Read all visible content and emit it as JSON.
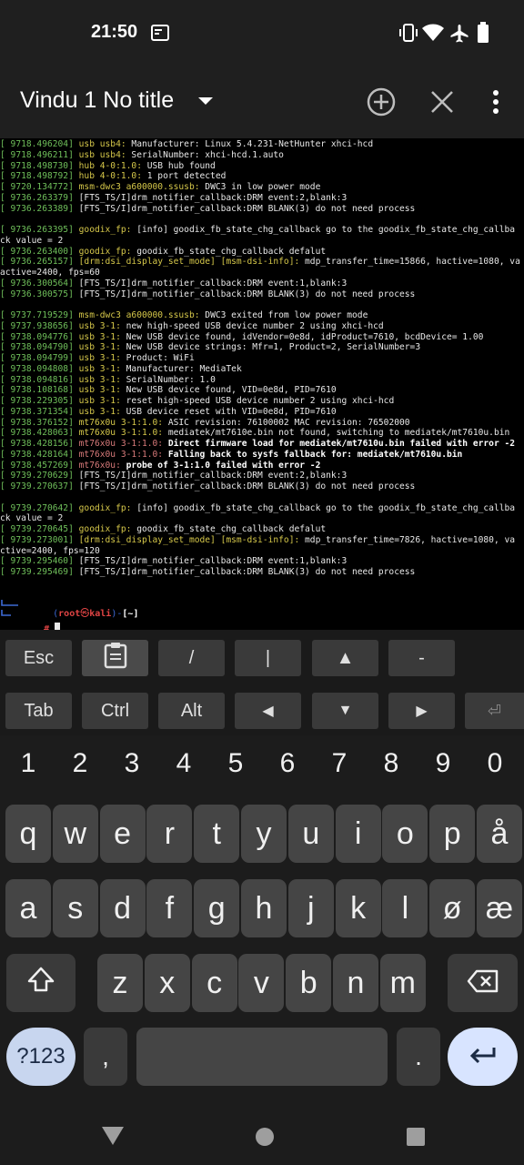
{
  "status_bar": {
    "time": "21:50",
    "icons": [
      "screenshot-icon",
      "vibrate-icon",
      "wifi-icon",
      "airplane-icon",
      "battery-icon"
    ]
  },
  "app_bar": {
    "title": "Vindu 1 No title",
    "icons": [
      "dropdown-arrow-icon",
      "add-session-icon",
      "close-session-icon",
      "overflow-menu-icon"
    ]
  },
  "terminal": {
    "lines": [
      {
        "ts": "[ 9718.496204]",
        "sub": "usb usb4:",
        "subc": "y",
        "msg": " Manufacturer: Linux 5.4.231-NetHunter xhci-hcd"
      },
      {
        "ts": "[ 9718.496211]",
        "sub": "usb usb4:",
        "subc": "y",
        "msg": " SerialNumber: xhci-hcd.1.auto"
      },
      {
        "ts": "[ 9718.498730]",
        "sub": "hub 4-0:1.0:",
        "subc": "y",
        "msg": " USB hub found"
      },
      {
        "ts": "[ 9718.498792]",
        "sub": "hub 4-0:1.0:",
        "subc": "y",
        "msg": " 1 port detected"
      },
      {
        "ts": "[ 9720.134772]",
        "sub": "msm-dwc3 a600000.ssusb:",
        "subc": "y",
        "msg": " DWC3 in low power mode"
      },
      {
        "ts": "[ 9736.263379]",
        "sub": "",
        "subc": "",
        "msg": " [FTS_TS/I]drm_notifier_callback:DRM event:2,blank:3"
      },
      {
        "ts": "[ 9736.263389]",
        "sub": "",
        "subc": "",
        "msg": " [FTS_TS/I]drm_notifier_callback:DRM BLANK(3) do not need process"
      },
      {
        "ts": "",
        "sub": "",
        "subc": "",
        "msg": ""
      },
      {
        "ts": "[ 9736.263395]",
        "sub": "goodix_fp:",
        "subc": "y",
        "msg": " [info] goodix_fb_state_chg_callback go to the goodix_fb_state_chg_callba"
      },
      {
        "ts": "",
        "sub": "",
        "subc": "",
        "msg": "ck value = 2"
      },
      {
        "ts": "[ 9736.263400]",
        "sub": "goodix_fp:",
        "subc": "y",
        "msg": " goodix_fb_state_chg_callback defalut"
      },
      {
        "ts": "[ 9736.265157]",
        "sub": "[drm:dsi_display_set_mode] [msm-dsi-info]:",
        "subc": "y",
        "msg": " mdp_transfer_time=15866, hactive=1080, va"
      },
      {
        "ts": "",
        "sub": "",
        "subc": "",
        "msg": "active=2400, fps=60"
      },
      {
        "ts": "[ 9736.300564]",
        "sub": "",
        "subc": "",
        "msg": " [FTS_TS/I]drm_notifier_callback:DRM event:1,blank:3"
      },
      {
        "ts": "[ 9736.300575]",
        "sub": "",
        "subc": "",
        "msg": " [FTS_TS/I]drm_notifier_callback:DRM BLANK(3) do not need process"
      },
      {
        "ts": "",
        "sub": "",
        "subc": "",
        "msg": ""
      },
      {
        "ts": "[ 9737.719529]",
        "sub": "msm-dwc3 a600000.ssusb:",
        "subc": "y",
        "msg": " DWC3 exited from low power mode"
      },
      {
        "ts": "[ 9737.938656]",
        "sub": "usb 3-1:",
        "subc": "y",
        "msg": " new high-speed USB device number 2 using xhci-hcd"
      },
      {
        "ts": "[ 9738.094776]",
        "sub": "usb 3-1:",
        "subc": "y",
        "msg": " New USB device found, idVendor=0e8d, idProduct=7610, bcdDevice= 1.00"
      },
      {
        "ts": "[ 9738.094790]",
        "sub": "usb 3-1:",
        "subc": "y",
        "msg": " New USB device strings: Mfr=1, Product=2, SerialNumber=3"
      },
      {
        "ts": "[ 9738.094799]",
        "sub": "usb 3-1:",
        "subc": "y",
        "msg": " Product: WiFi"
      },
      {
        "ts": "[ 9738.094808]",
        "sub": "usb 3-1:",
        "subc": "y",
        "msg": " Manufacturer: MediaTek"
      },
      {
        "ts": "[ 9738.094816]",
        "sub": "usb 3-1:",
        "subc": "y",
        "msg": " SerialNumber: 1.0"
      },
      {
        "ts": "[ 9738.108168]",
        "sub": "usb 3-1:",
        "subc": "y",
        "msg": " New USB device found, VID=0e8d, PID=7610"
      },
      {
        "ts": "[ 9738.229305]",
        "sub": "usb 3-1:",
        "subc": "y",
        "msg": " reset high-speed USB device number 2 using xhci-hcd"
      },
      {
        "ts": "[ 9738.371354]",
        "sub": "usb 3-1:",
        "subc": "y",
        "msg": " USB device reset with VID=0e8d, PID=7610"
      },
      {
        "ts": "[ 9738.376152]",
        "sub": "mt76x0u 3-1:1.0:",
        "subc": "y",
        "msg": " ASIC revision: 76100002 MAC revision: 76502000"
      },
      {
        "ts": "[ 9738.428063]",
        "sub": "mt76x0u 3-1:1.0:",
        "subc": "y",
        "msg": " mediatek/mt7610e.bin not found, switching to mediatek/mt7610u.bin"
      },
      {
        "ts": "[ 9738.428156]",
        "sub": "mt76x0u 3-1:1.0:",
        "subc": "r",
        "msg": " Direct firmware load for mediatek/mt7610u.bin failed with error -2",
        "bold": true
      },
      {
        "ts": "[ 9738.428164]",
        "sub": "mt76x0u 3-1:1.0:",
        "subc": "r",
        "msg": " Falling back to sysfs fallback for: mediatek/mt7610u.bin",
        "bold": true
      },
      {
        "ts": "[ 9738.457269]",
        "sub": "mt76x0u:",
        "subc": "r",
        "msg": " probe of 3-1:1.0 failed with error -2",
        "bold": true
      },
      {
        "ts": "[ 9739.270629]",
        "sub": "",
        "subc": "",
        "msg": " [FTS_TS/I]drm_notifier_callback:DRM event:2,blank:3"
      },
      {
        "ts": "[ 9739.270637]",
        "sub": "",
        "subc": "",
        "msg": " [FTS_TS/I]drm_notifier_callback:DRM BLANK(3) do not need process"
      },
      {
        "ts": "",
        "sub": "",
        "subc": "",
        "msg": ""
      },
      {
        "ts": "[ 9739.270642]",
        "sub": "goodix_fp:",
        "subc": "y",
        "msg": " [info] goodix_fb_state_chg_callback go to the goodix_fb_state_chg_callba"
      },
      {
        "ts": "",
        "sub": "",
        "subc": "",
        "msg": "ck value = 2"
      },
      {
        "ts": "[ 9739.270645]",
        "sub": "goodix_fp:",
        "subc": "y",
        "msg": " goodix_fb_state_chg_callback defalut"
      },
      {
        "ts": "[ 9739.273001]",
        "sub": "[drm:dsi_display_set_mode] [msm-dsi-info]:",
        "subc": "y",
        "msg": " mdp_transfer_time=7826, hactive=1080, va"
      },
      {
        "ts": "",
        "sub": "",
        "subc": "",
        "msg": "ctive=2400, fps=120"
      },
      {
        "ts": "[ 9739.295460]",
        "sub": "",
        "subc": "",
        "msg": " [FTS_TS/I]drm_notifier_callback:DRM event:1,blank:3"
      },
      {
        "ts": "[ 9739.295469]",
        "sub": "",
        "subc": "",
        "msg": " [FTS_TS/I]drm_notifier_callback:DRM BLANK(3) do not need process"
      }
    ],
    "prompt_user": "root",
    "prompt_at": "㉿",
    "prompt_host": "kali",
    "prompt_dir": "[~]",
    "prompt_symbol": "#"
  },
  "extra_keys": {
    "row1": [
      "Esc",
      "clipboard-icon",
      "/",
      "|",
      "▲",
      "-"
    ],
    "row2": [
      "Tab",
      "Ctrl",
      "Alt",
      "◀",
      "▼",
      "▶",
      "⏎"
    ]
  },
  "keyboard": {
    "numbers": [
      "1",
      "2",
      "3",
      "4",
      "5",
      "6",
      "7",
      "8",
      "9",
      "0"
    ],
    "row1": [
      "q",
      "w",
      "e",
      "r",
      "t",
      "y",
      "u",
      "i",
      "o",
      "p",
      "å"
    ],
    "row2": [
      "a",
      "s",
      "d",
      "f",
      "g",
      "h",
      "j",
      "k",
      "l",
      "ø",
      "æ"
    ],
    "row3": [
      "z",
      "x",
      "c",
      "v",
      "b",
      "n",
      "m"
    ],
    "symbols_label": "?123",
    "comma": ",",
    "period": "."
  },
  "nav_bar": {
    "icons": [
      "back-icon",
      "home-icon",
      "recents-icon"
    ]
  },
  "colors": {
    "timestamp": "#6fbf5a",
    "subsystem": "#d6c84a",
    "prompt_user": "#e04444",
    "prompt_frame": "#3d6ad6",
    "enter_key": "#d8e4ff",
    "symbols_key": "#c8d6ef"
  }
}
